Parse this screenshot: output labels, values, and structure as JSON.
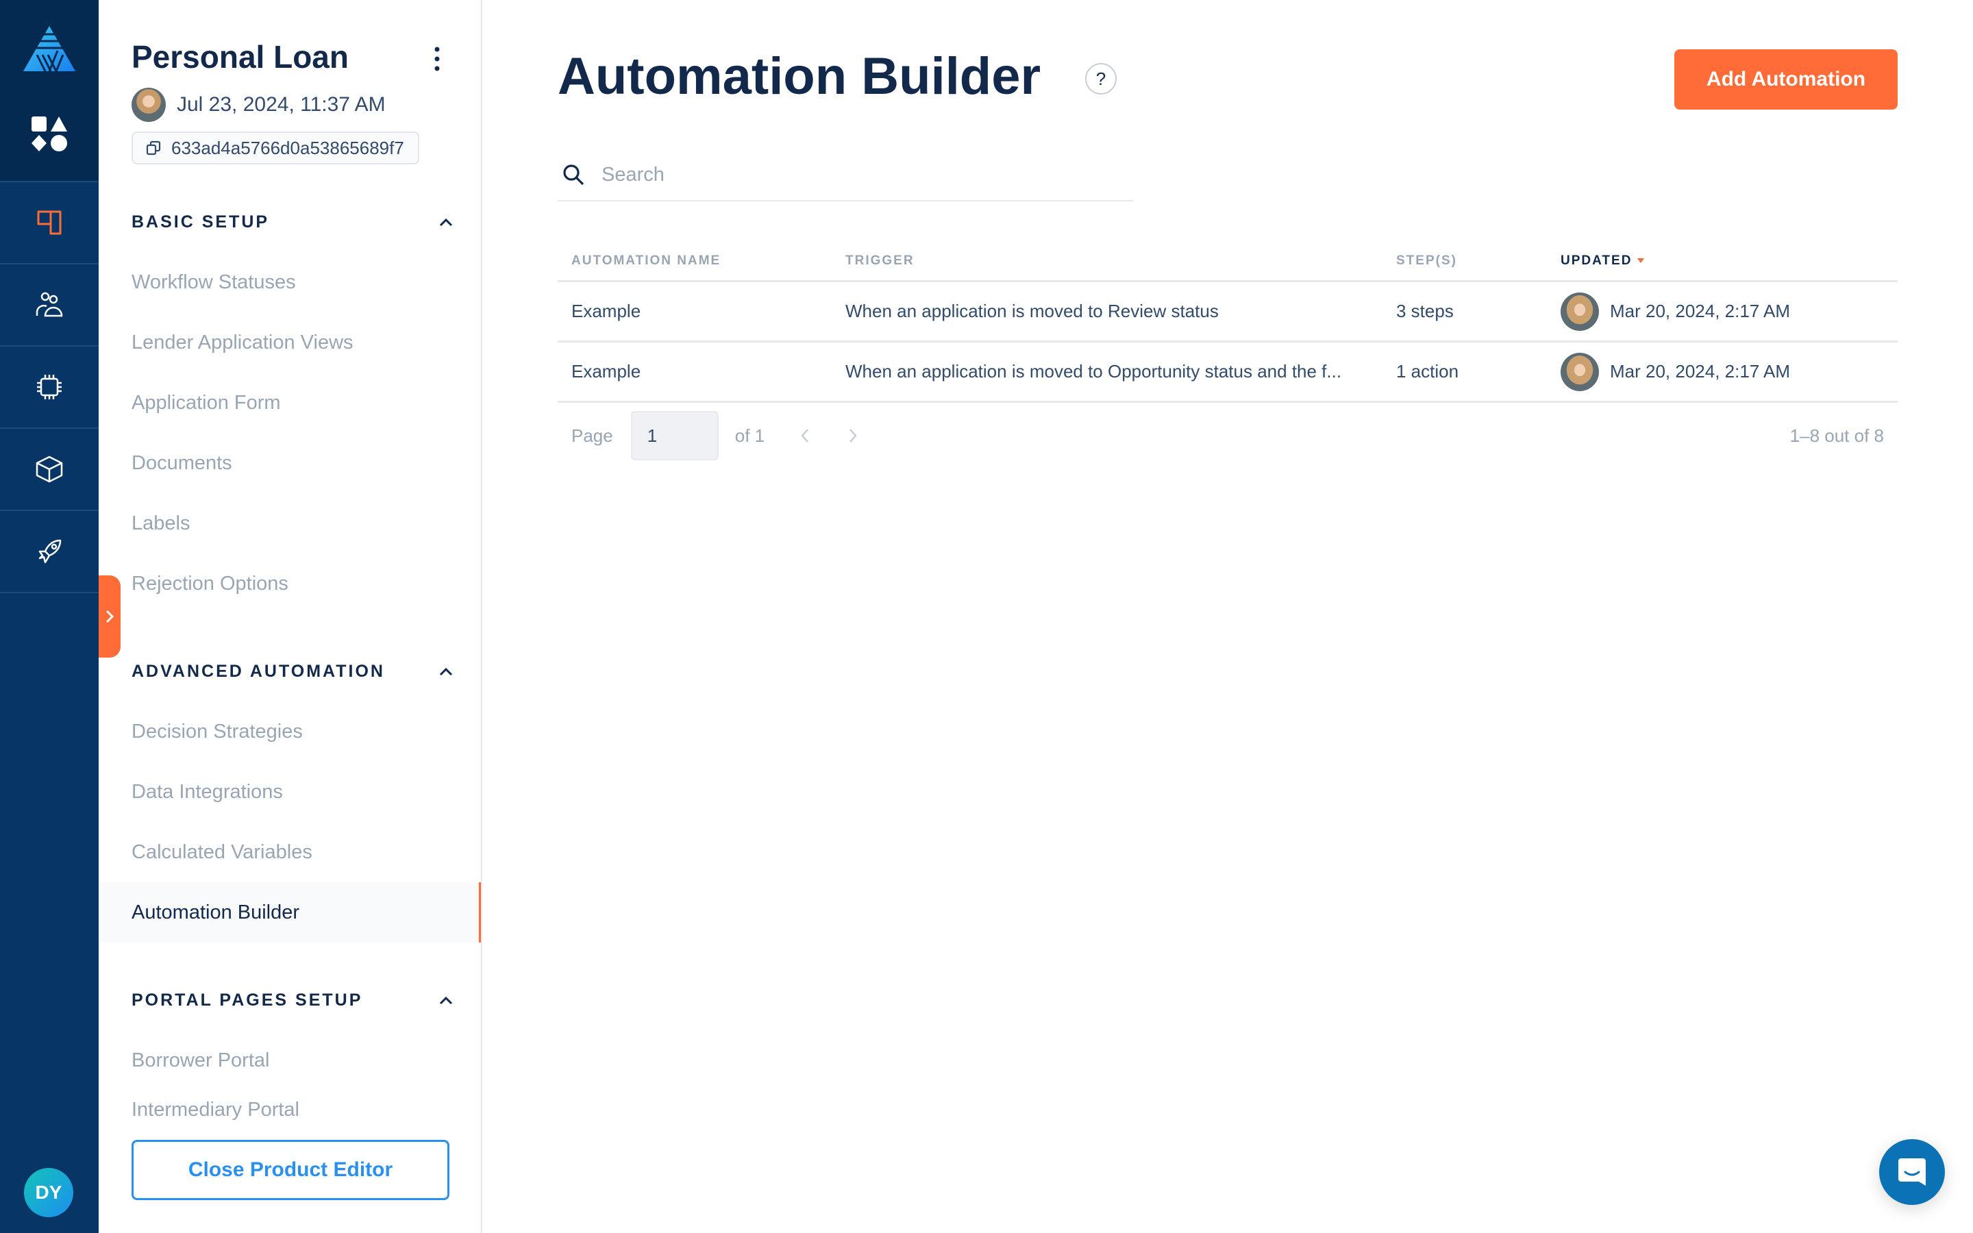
{
  "rail": {
    "logo_icon": "brand-triangle-logo",
    "apps_icon": "shapes-icon",
    "items": [
      {
        "name": "products",
        "icon": "product-layout-icon",
        "active": true
      },
      {
        "name": "users",
        "icon": "users-icon",
        "active": false
      },
      {
        "name": "processing",
        "icon": "chip-icon",
        "active": false
      },
      {
        "name": "packages",
        "icon": "cube-icon",
        "active": false
      },
      {
        "name": "launch",
        "icon": "rocket-icon",
        "active": false
      }
    ],
    "user_initials": "DY"
  },
  "sidebar": {
    "product_title": "Personal Loan",
    "updated_at": "Jul 23, 2024, 11:37 AM",
    "product_id": "633ad4a5766d0a53865689f7",
    "sections": [
      {
        "title": "BASIC SETUP",
        "items": [
          "Workflow Statuses",
          "Lender Application Views",
          "Application Form",
          "Documents",
          "Labels",
          "Rejection Options"
        ]
      },
      {
        "title": "ADVANCED AUTOMATION",
        "items": [
          "Decision Strategies",
          "Data Integrations",
          "Calculated Variables",
          "Automation Builder"
        ]
      },
      {
        "title": "PORTAL PAGES SETUP",
        "items": [
          "Borrower Portal",
          "Intermediary Portal"
        ]
      }
    ],
    "active_item": "Automation Builder",
    "close_button": "Close Product Editor"
  },
  "main": {
    "title": "Automation Builder",
    "help_label": "?",
    "add_button": "Add Automation",
    "search": {
      "placeholder": "Search",
      "value": ""
    },
    "table": {
      "columns": [
        "AUTOMATION NAME",
        "TRIGGER",
        "STEP(S)",
        "UPDATED"
      ],
      "sorted_column": "UPDATED",
      "sort_direction": "desc",
      "rows": [
        {
          "name": "Example",
          "trigger": "When an application is moved to Review status",
          "steps": "3 steps",
          "updated": "Mar 20, 2024, 2:17 AM"
        },
        {
          "name": "Example",
          "trigger": "When an application is moved to Opportunity status and the f...",
          "steps": "1 action",
          "updated": "Mar 20, 2024, 2:17 AM"
        }
      ]
    },
    "pagination": {
      "page_label": "Page",
      "current_page": "1",
      "of_label": "of 1",
      "range": "1–8 out of 8"
    }
  },
  "colors": {
    "accent": "#ff6c37",
    "rail_bg": "#063566",
    "text_primary": "#13294b",
    "text_muted": "#9aa5b4",
    "link_blue": "#2a90ee",
    "chat_blue": "#0b72b5"
  }
}
